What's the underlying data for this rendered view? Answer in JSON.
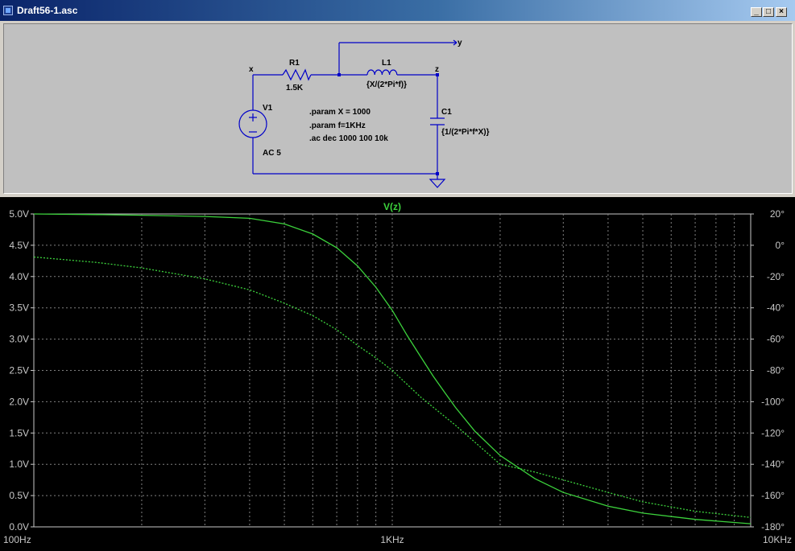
{
  "window": {
    "title": "Draft56-1.asc",
    "buttons": [
      "_",
      "□",
      "×"
    ]
  },
  "schematic": {
    "nets": {
      "x": "x",
      "y": "y",
      "z": "z"
    },
    "components": {
      "R1": {
        "name": "R1",
        "value": "1.5K"
      },
      "L1": {
        "name": "L1",
        "value": "{X/(2*Pi*f)}"
      },
      "C1": {
        "name": "C1",
        "value": "{1/(2*Pi*f*X)}"
      },
      "V1": {
        "name": "V1",
        "value": "AC 5"
      }
    },
    "directives": [
      ".param  X = 1000",
      ".param f=1KHz",
      ".ac dec 1000 100 10k"
    ]
  },
  "plot": {
    "trace_label": "V(z)",
    "colors": {
      "background": "#000000",
      "grid": "#808080",
      "trace": "#3cd23c",
      "axis_text": "#c8c8c8"
    },
    "x_axis": {
      "scale": "log",
      "min_hz": 100,
      "max_hz": 10000,
      "labels": [
        "100Hz",
        "1KHz",
        "10KHz"
      ]
    },
    "y_left": {
      "min": 0,
      "max": 5,
      "step": 0.5,
      "labels": [
        "5.0V",
        "4.5V",
        "4.0V",
        "3.5V",
        "3.0V",
        "2.5V",
        "2.0V",
        "1.5V",
        "1.0V",
        "0.5V",
        "0.0V"
      ]
    },
    "y_right": {
      "min": -180,
      "max": 20,
      "step": 20,
      "labels": [
        "20°",
        "0°",
        "-20°",
        "-40°",
        "-60°",
        "-80°",
        "-100°",
        "-120°",
        "-140°",
        "-160°",
        "-180°"
      ]
    }
  },
  "chart_data": {
    "type": "line",
    "title": "V(z)",
    "x_scale": "log",
    "xlim": [
      100,
      10000
    ],
    "ylim_left": [
      0,
      5
    ],
    "ylim_right": [
      -180,
      20
    ],
    "grid": true,
    "series": [
      {
        "name": "V(z)",
        "axis": "left",
        "style": "solid",
        "x": [
          100,
          150,
          200,
          300,
          400,
          500,
          600,
          700,
          800,
          900,
          1000,
          1100,
          1200,
          1300,
          1400,
          1500,
          1700,
          2000,
          2500,
          3000,
          4000,
          5000,
          7000,
          10000
        ],
        "values": [
          5.0,
          4.99,
          4.98,
          4.96,
          4.93,
          4.84,
          4.68,
          4.46,
          4.17,
          3.83,
          3.46,
          3.06,
          2.72,
          2.41,
          2.15,
          1.91,
          1.53,
          1.14,
          0.77,
          0.55,
          0.33,
          0.22,
          0.12,
          0.05
        ]
      },
      {
        "name": "phase",
        "axis": "right",
        "style": "dotted",
        "x": [
          100,
          150,
          200,
          300,
          400,
          500,
          600,
          700,
          800,
          900,
          1000,
          1200,
          1500,
          2000,
          2500,
          3000,
          4000,
          5000,
          7000,
          10000
        ],
        "values": [
          -7.5,
          -11,
          -14.5,
          -21.5,
          -28.5,
          -37,
          -45,
          -54,
          -64,
          -72,
          -80,
          -97,
          -115,
          -140,
          -145,
          -150,
          -158,
          -164,
          -170,
          -174
        ]
      }
    ]
  }
}
